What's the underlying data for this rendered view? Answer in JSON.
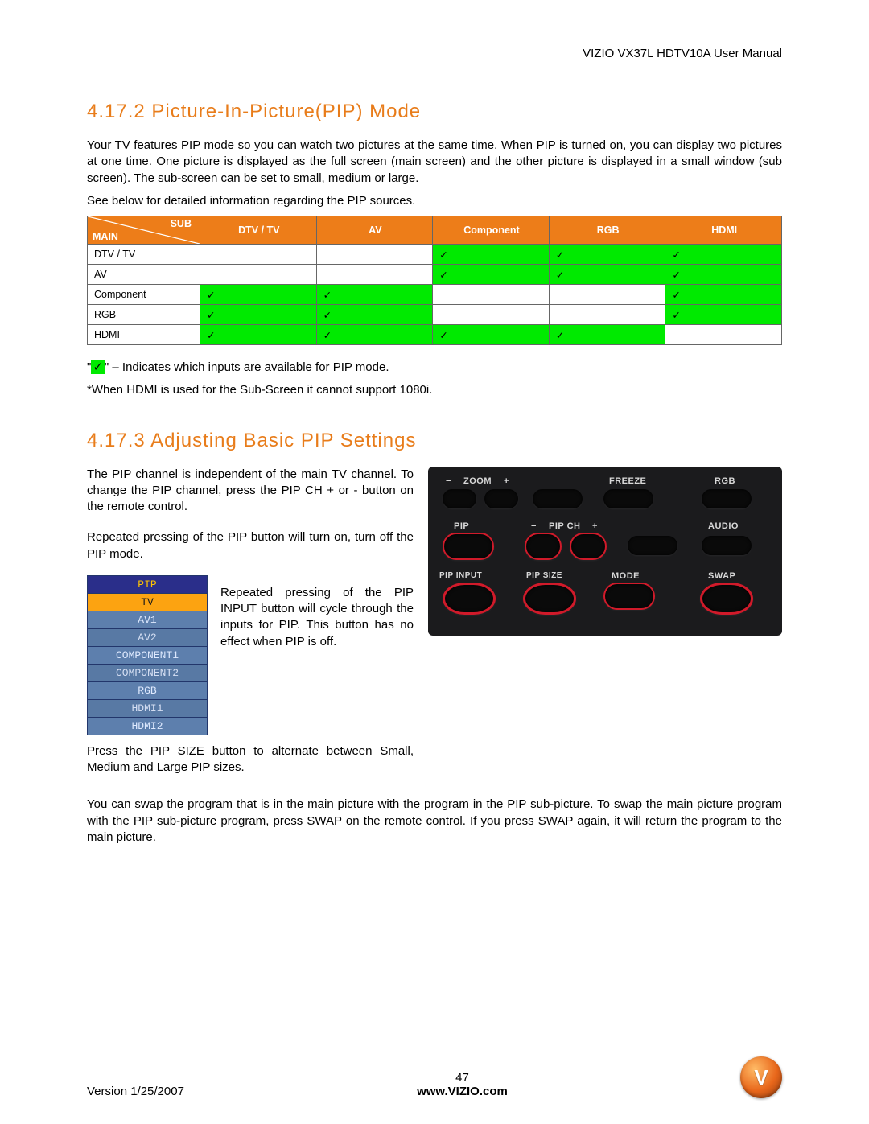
{
  "header": {
    "title": "VIZIO VX37L HDTV10A User Manual"
  },
  "section1": {
    "heading": "4.17.2 Picture-In-Picture(PIP) Mode",
    "p1": "Your TV features PIP mode so you can watch two pictures at the same time. When PIP is turned on, you can display two pictures at one time. One picture is displayed as the full screen (main screen) and the other picture is displayed in a small window (sub screen). The sub-screen can be set to small, medium or large.",
    "p2": "See below for detailed information regarding the PIP sources.",
    "table": {
      "diag_sub": "SUB",
      "diag_main": "MAIN",
      "cols": [
        "DTV / TV",
        "AV",
        "Component",
        "RGB",
        "HDMI"
      ],
      "rows": [
        "DTV / TV",
        "AV",
        "Component",
        "RGB",
        "HDMI"
      ],
      "grid": [
        [
          "no",
          "no",
          "yes",
          "yes",
          "yes"
        ],
        [
          "no",
          "no",
          "yes",
          "yes",
          "yes"
        ],
        [
          "yes",
          "yes",
          "no",
          "no",
          "yes"
        ],
        [
          "yes",
          "yes",
          "no",
          "no",
          "yes"
        ],
        [
          "yes",
          "yes",
          "yes",
          "yes",
          "no"
        ]
      ],
      "tick": "✓"
    },
    "legend_quote1": "\"",
    "legend_quote2": "\" – Indicates which inputs are available for PIP mode.",
    "legend_tick": "✓",
    "note": "*When HDMI is used for the Sub-Screen it cannot support 1080i."
  },
  "section2": {
    "heading": "4.17.3 Adjusting Basic PIP Settings",
    "p1": "The PIP channel is independent of the main TV channel. To change the PIP channel, press the PIP CH + or - button on the remote control.",
    "p2": "Repeated pressing of the PIP button will turn on, turn off the PIP mode.",
    "p3": "Repeated pressing of the PIP INPUT button will cycle through the inputs for PIP.  This button has no effect when PIP is off.",
    "p4": "Press the PIP SIZE button to alternate between Small, Medium and Large PIP sizes.",
    "p5": "You can swap the program that is in the main picture with the program in the PIP sub-picture.  To swap the main picture program with the PIP sub-picture program, press SWAP on the remote control. If you press SWAP again, it will return the program to the main picture.",
    "pip_menu": {
      "title": "PIP",
      "items": [
        "TV",
        "AV1",
        "AV2",
        "COMPONENT1",
        "COMPONENT2",
        "RGB",
        "HDMI1",
        "HDMI2"
      ]
    },
    "remote": {
      "labels": {
        "zoom_minus": "−",
        "zoom": "ZOOM",
        "zoom_plus": "+",
        "freeze": "FREEZE",
        "rgb": "RGB",
        "pip": "PIP",
        "pipch_minus": "−",
        "pipch": "PIP CH",
        "pipch_plus": "+",
        "audio": "AUDIO",
        "pip_input": "PIP INPUT",
        "pip_size": "PIP SIZE",
        "mode": "MODE",
        "swap": "SWAP"
      }
    }
  },
  "footer": {
    "version": "Version 1/25/2007",
    "page": "47",
    "site": "www.VIZIO.com",
    "logo": "V"
  }
}
